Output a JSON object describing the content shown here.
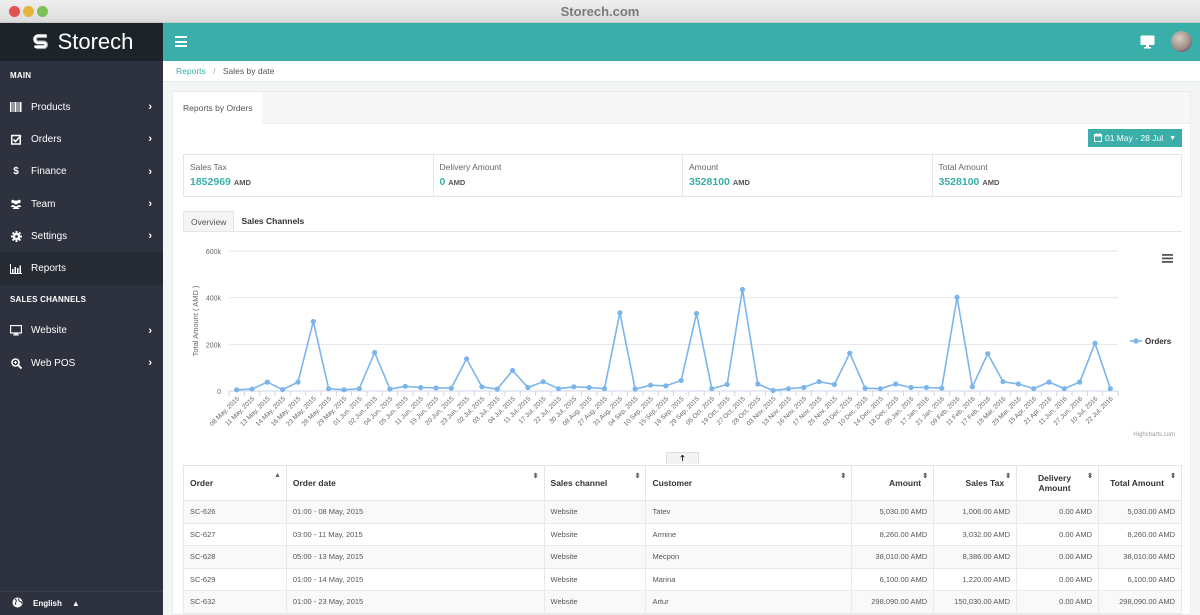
{
  "window": {
    "title": "Storech.com"
  },
  "brand": {
    "name": "Storech"
  },
  "sidebar": {
    "main_label": "MAIN",
    "items": [
      {
        "label": "Products",
        "icon": "barcode-icon",
        "has_chevron": true
      },
      {
        "label": "Orders",
        "icon": "check-square-icon",
        "has_chevron": true
      },
      {
        "label": "Finance",
        "icon": "dollar-icon",
        "has_chevron": true
      },
      {
        "label": "Team",
        "icon": "users-icon",
        "has_chevron": true
      },
      {
        "label": "Settings",
        "icon": "gear-icon",
        "has_chevron": true
      },
      {
        "label": "Reports",
        "icon": "bar-chart-icon",
        "has_chevron": false,
        "active": true
      }
    ],
    "channels_label": "SALES CHANNELS",
    "channels": [
      {
        "label": "Website",
        "icon": "monitor-icon",
        "has_chevron": true
      },
      {
        "label": "Web POS",
        "icon": "search-plus-icon",
        "has_chevron": true
      }
    ],
    "language": "English"
  },
  "breadcrumb": {
    "parent": "Reports",
    "current": "Sales by date"
  },
  "panel": {
    "tab": "Reports by Orders",
    "date_range": "01 May - 28 Jul"
  },
  "stats": [
    {
      "label": "Sales Tax",
      "value": "1852969",
      "unit": "AMD"
    },
    {
      "label": "Delivery Amount",
      "value": "0",
      "unit": "AMD"
    },
    {
      "label": "Amount",
      "value": "3528100",
      "unit": "AMD"
    },
    {
      "label": "Total Amount",
      "value": "3528100",
      "unit": "AMD"
    }
  ],
  "subtabs": [
    {
      "label": "Overview",
      "active": true
    },
    {
      "label": "Sales Channels",
      "active": false
    }
  ],
  "chart_data": {
    "type": "line",
    "title": "",
    "xlabel": "",
    "ylabel": "Total Amount ( AMD )",
    "ylim": [
      0,
      600000
    ],
    "yticks": [
      0,
      200000,
      400000,
      600000
    ],
    "ytick_labels": [
      "0",
      "200k",
      "400k",
      "600k"
    ],
    "grid": true,
    "legend": "right",
    "credits": "Highcharts.com",
    "color": "#7cb5ec",
    "categories": [
      "08 May, 2015",
      "11 May, 2015",
      "13 May, 2015",
      "14 May, 2015",
      "16 May, 2015",
      "23 May, 2015",
      "28 May, 2015",
      "29 May, 2015",
      "01 Jun, 2015",
      "02 Jun, 2015",
      "04 Jun, 2015",
      "05 Jun, 2015",
      "11 Jun, 2015",
      "19 Jun, 2015",
      "20 Jun, 2015",
      "23 Jun, 2015",
      "02 Jul, 2015",
      "03 Jul, 2015",
      "04 Jul, 2015",
      "11 Jul, 2015",
      "17 Jul, 2015",
      "22 Jul, 2015",
      "30 Jul, 2015",
      "08 Aug, 2015",
      "27 Aug, 2015",
      "31 Aug, 2015",
      "04 Sep, 2015",
      "10 Sep, 2015",
      "15 Sep, 2015",
      "18 Sep, 2015",
      "29 Sep, 2015",
      "05 Oct, 2015",
      "19 Oct, 2015",
      "27 Oct, 2015",
      "28 Oct, 2015",
      "03 Nov, 2015",
      "13 Nov, 2015",
      "16 Nov, 2015",
      "17 Nov, 2015",
      "25 Nov, 2015",
      "03 Dec, 2015",
      "10 Dec, 2015",
      "14 Dec, 2015",
      "18 Dec, 2015",
      "05 Jan, 2016",
      "17 Jan, 2016",
      "21 Jan, 2016",
      "09 Feb, 2016",
      "11 Feb, 2016",
      "17 Feb, 2016",
      "18 Mar, 2016",
      "29 Mar, 2016",
      "15 Apr, 2016",
      "21 Apr, 2016",
      "11 Jun, 2016",
      "27 Jun, 2016",
      "10 Jul, 2016",
      "22 Jul, 2016"
    ],
    "series": [
      {
        "name": "Orders",
        "values": [
          5030,
          8260,
          38010,
          6100,
          38000,
          298090,
          10000,
          5000,
          10000,
          165000,
          8000,
          20000,
          15000,
          13000,
          12000,
          138000,
          18000,
          8000,
          88000,
          15000,
          40000,
          10000,
          18000,
          15000,
          10000,
          335000,
          8000,
          25000,
          22000,
          45000,
          332000,
          10000,
          28000,
          435000,
          30000,
          2000,
          10000,
          15000,
          40000,
          28000,
          162000,
          12000,
          10000,
          30000,
          15000,
          15000,
          12000,
          402000,
          18000,
          160000,
          40000,
          30000,
          10000,
          38000,
          10000,
          38000,
          205000,
          10000
        ]
      }
    ]
  },
  "table": {
    "columns": [
      {
        "label": "Order",
        "sort": "asc"
      },
      {
        "label": "Order date",
        "sort": "both"
      },
      {
        "label": "Sales channel",
        "sort": "both"
      },
      {
        "label": "Customer",
        "sort": "both"
      },
      {
        "label": "Amount",
        "sort": "both"
      },
      {
        "label": "Sales Tax",
        "sort": "both"
      },
      {
        "label": "Delivery Amount",
        "sort": "both"
      },
      {
        "label": "Total Amount",
        "sort": "both"
      }
    ],
    "rows": [
      [
        "SC-626",
        "01:00 - 08 May, 2015",
        "Website",
        "Tatev",
        "5,030.00 AMD",
        "1,006.00 AMD",
        "0.00 AMD",
        "5,030.00 AMD"
      ],
      [
        "SC-627",
        "03:00 - 11 May, 2015",
        "Website",
        "Armine",
        "8,260.00 AMD",
        "3,032.00 AMD",
        "0.00 AMD",
        "8,260.00 AMD"
      ],
      [
        "SC-628",
        "05:00 - 13 May, 2015",
        "Website",
        "Мecpon",
        "38,010.00 AMD",
        "8,386.00 AMD",
        "0.00 AMD",
        "38,010.00 AMD"
      ],
      [
        "SC-629",
        "01:00 - 14 May, 2015",
        "Website",
        "Marina",
        "6,100.00 AMD",
        "1,220.00 AMD",
        "0.00 AMD",
        "6,100.00 AMD"
      ],
      [
        "SC-632",
        "01:00 - 23 May, 2015",
        "Website",
        "Artur",
        "298,090.00 AMD",
        "150,030.00 AMD",
        "0.00 AMD",
        "298,090.00 AMD"
      ]
    ]
  }
}
